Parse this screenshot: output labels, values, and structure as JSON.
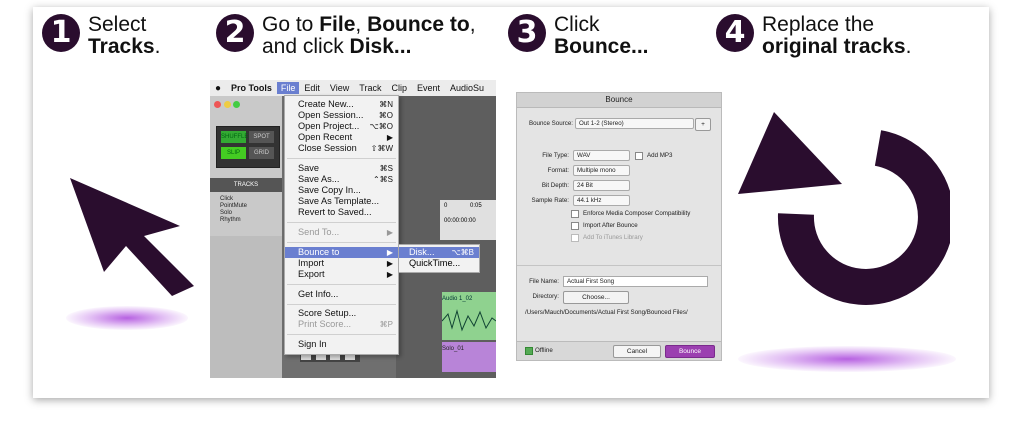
{
  "steps": [
    {
      "number": "1",
      "line1": "Select",
      "line2": "Tracks",
      "line2_suffix": "."
    },
    {
      "number": "2",
      "l1_pre": "Go to ",
      "l1_b1": "File",
      "l1_mid": ", ",
      "l1_b2": "Bounce to",
      "l1_post": ",",
      "l2_pre": "and click ",
      "l2_b": "Disk..."
    },
    {
      "number": "3",
      "line1": "Click",
      "line2": "Bounce..."
    },
    {
      "number": "4",
      "line1": "Replace the",
      "line2": "original tracks",
      "line2_suffix": "."
    }
  ],
  "protools": {
    "menubar": [
      "Pro Tools",
      "File",
      "Edit",
      "View",
      "Track",
      "Clip",
      "Event",
      "AudioSu"
    ],
    "shuffle": "SHUFFLE",
    "spot": "SPOT",
    "slip": "SLIP",
    "grid": "GRID",
    "tracks_header": "TRACKS",
    "track_names": [
      "Click",
      "PointMute",
      "Solo",
      "Rhythm"
    ],
    "ruler": [
      "0",
      "0:05",
      "00:00:00:00"
    ],
    "region1": "Audio 1_02",
    "region2": "Solo_01",
    "file_menu": [
      {
        "label": "Create New...",
        "key": "⌘N"
      },
      {
        "label": "Open Session...",
        "key": "⌘O"
      },
      {
        "label": "Open Project...",
        "key": "⌥⌘O"
      },
      {
        "label": "Open Recent",
        "key": "▶"
      },
      {
        "label": "Close Session",
        "key": "⇧⌘W"
      },
      {
        "label": "Save",
        "key": "⌘S"
      },
      {
        "label": "Save As...",
        "key": "⌃⌘S"
      },
      {
        "label": "Save Copy In...",
        "key": ""
      },
      {
        "label": "Save As Template...",
        "key": ""
      },
      {
        "label": "Revert to Saved...",
        "key": ""
      },
      {
        "label": "Send To...",
        "key": "▶"
      },
      {
        "label": "Bounce to",
        "key": "▶"
      },
      {
        "label": "Import",
        "key": "▶"
      },
      {
        "label": "Export",
        "key": "▶"
      },
      {
        "label": "Get Info...",
        "key": ""
      },
      {
        "label": "Score Setup...",
        "key": ""
      },
      {
        "label": "Print Score...",
        "key": "⌘P"
      },
      {
        "label": "Sign In",
        "key": ""
      }
    ],
    "bounce_submenu": [
      {
        "label": "Disk...",
        "key": "⌥⌘B"
      },
      {
        "label": "QuickTime...",
        "key": ""
      }
    ]
  },
  "bounce_dialog": {
    "title": "Bounce",
    "source_label": "Bounce Source:",
    "source_value": "Out 1-2 (Stereo)",
    "filetype_label": "File Type:",
    "filetype_value": "WAV",
    "addmp3": "Add MP3",
    "format_label": "Format:",
    "format_value": "Multiple mono",
    "bitdepth_label": "Bit Depth:",
    "bitdepth_value": "24 Bit",
    "samplerate_label": "Sample Rate:",
    "samplerate_value": "44.1 kHz",
    "opt1": "Enforce Media Composer Compatibility",
    "opt2": "Import After Bounce",
    "opt3": "Add To iTunes Library",
    "filename_label": "File Name:",
    "filename_value": "Actual First Song",
    "directory_label": "Directory:",
    "choose": "Choose...",
    "path": "/Users/Mauch/Documents/Actual First Song/Bounced Files/",
    "offline": "Offline",
    "cancel": "Cancel",
    "bounce": "Bounce"
  },
  "colors": {
    "accent": "#2a0d2e",
    "glow": "#a046dc",
    "highlight": "#6a7fd0",
    "bounce_btn": "#9b3fb0"
  },
  "icons": [
    "cursor-arrow-icon",
    "replace-loop-arrow-icon"
  ]
}
